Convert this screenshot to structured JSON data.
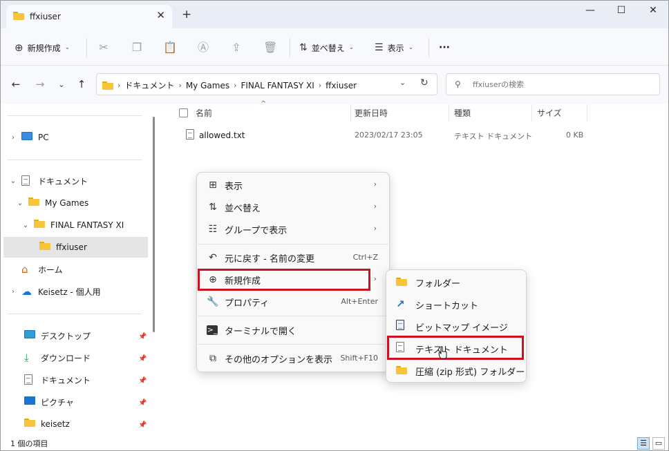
{
  "tab": {
    "title": "ffxiuser",
    "close": "✕",
    "new_tab": "+"
  },
  "window_controls": {
    "minimize": "—",
    "maximize": "☐",
    "close": "✕"
  },
  "toolbar": {
    "new_label": "新規作成",
    "sort_label": "並べ替え",
    "view_label": "表示",
    "more_label": "···"
  },
  "breadcrumbs": [
    "ドキュメント",
    "My Games",
    "FINAL FANTASY XI",
    "ffxiuser"
  ],
  "search": {
    "placeholder": "ffxiuserの検索"
  },
  "sidebar": {
    "items": [
      {
        "label": "PC"
      },
      {
        "label": "ドキュメント"
      },
      {
        "label": "My Games"
      },
      {
        "label": "FINAL FANTASY XI"
      },
      {
        "label": "ffxiuser"
      },
      {
        "label": "ホーム"
      },
      {
        "label": "Keisetz - 個人用"
      },
      {
        "label": "デスクトップ"
      },
      {
        "label": "ダウンロード"
      },
      {
        "label": "ドキュメント"
      },
      {
        "label": "ピクチャ"
      },
      {
        "label": "keisetz"
      }
    ]
  },
  "columns": {
    "name": "名前",
    "modified": "更新日時",
    "type": "種類",
    "size": "サイズ"
  },
  "files": [
    {
      "name": "allowed.txt",
      "modified": "2023/02/17 23:05",
      "type": "テキスト ドキュメント",
      "size": "0 KB"
    }
  ],
  "status": {
    "count": "1 個の項目"
  },
  "context_menu": {
    "items": [
      {
        "label": "表示",
        "icon": "grid-icon",
        "arrow": "›"
      },
      {
        "label": "並べ替え",
        "icon": "sort-icon",
        "arrow": "›"
      },
      {
        "label": "グループで表示",
        "icon": "group-icon",
        "arrow": "›"
      },
      {
        "label": "元に戻す - 名前の変更",
        "icon": "undo-icon",
        "shortcut": "Ctrl+Z"
      },
      {
        "label": "新規作成",
        "icon": "plus-circle-icon",
        "arrow": "›"
      },
      {
        "label": "プロパティ",
        "icon": "wrench-icon",
        "shortcut": "Alt+Enter"
      },
      {
        "label": "ターミナルで開く",
        "icon": "terminal-icon"
      },
      {
        "label": "その他のオプションを表示",
        "icon": "share-icon",
        "shortcut": "Shift+F10"
      }
    ]
  },
  "submenu": {
    "items": [
      {
        "label": "フォルダー",
        "icon": "folder-icon"
      },
      {
        "label": "ショートカット",
        "icon": "shortcut-icon"
      },
      {
        "label": "ビットマップ イメージ",
        "icon": "bitmap-icon"
      },
      {
        "label": "テキスト ドキュメント",
        "icon": "text-doc-icon"
      },
      {
        "label": "圧縮 (zip 形式) フォルダー",
        "icon": "zip-folder-icon"
      }
    ]
  },
  "highlight_color": "#cc1020",
  "accent_color": "#1c73d2"
}
